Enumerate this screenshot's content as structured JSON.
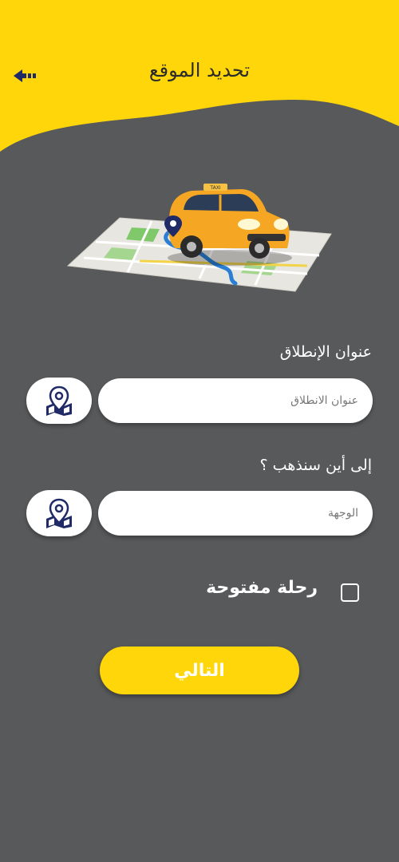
{
  "header": {
    "title": "تحديد الموقع",
    "back_icon": "arrow-left-icon",
    "accent_color": "#ffd60a"
  },
  "hero": {
    "illustration": "taxi-on-map"
  },
  "start": {
    "label": "عنوان الإنطلاق",
    "placeholder": "عنوان الانطلاق",
    "icon": "map-pin-icon"
  },
  "destination": {
    "label": "إلى أين سنذهب ؟",
    "placeholder": "الوجهة",
    "icon": "map-pin-icon"
  },
  "open_trip": {
    "label": "رحلة مفتوحة",
    "checked": false
  },
  "next_button": {
    "label": "التالي"
  }
}
